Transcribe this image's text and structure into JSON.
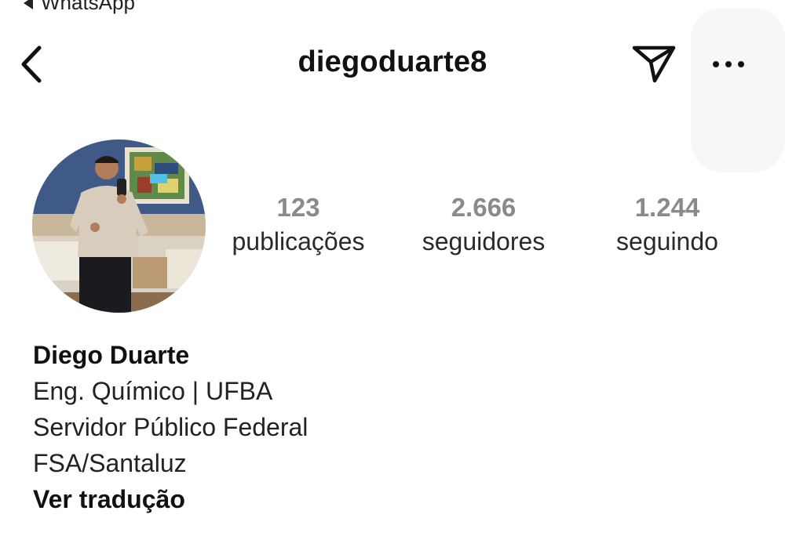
{
  "status_bar": {
    "back_app_label": "WhatsApp"
  },
  "header": {
    "username": "diegoduarte8",
    "icons": {
      "back": "chevron-left-icon",
      "send": "paper-plane-icon",
      "more": "more-horizontal-icon"
    }
  },
  "profile": {
    "avatar": "profile-photo",
    "stats": [
      {
        "value": "123",
        "label": "publicações"
      },
      {
        "value": "2.666",
        "label": "seguidores"
      },
      {
        "value": "1.244",
        "label": "seguindo"
      }
    ],
    "bio": {
      "name": "Diego Duarte",
      "lines": [
        "Eng. Químico | UFBA",
        "Servidor Público Federal",
        "FSA/Santaluz"
      ],
      "translate_label": "Ver tradução"
    }
  }
}
